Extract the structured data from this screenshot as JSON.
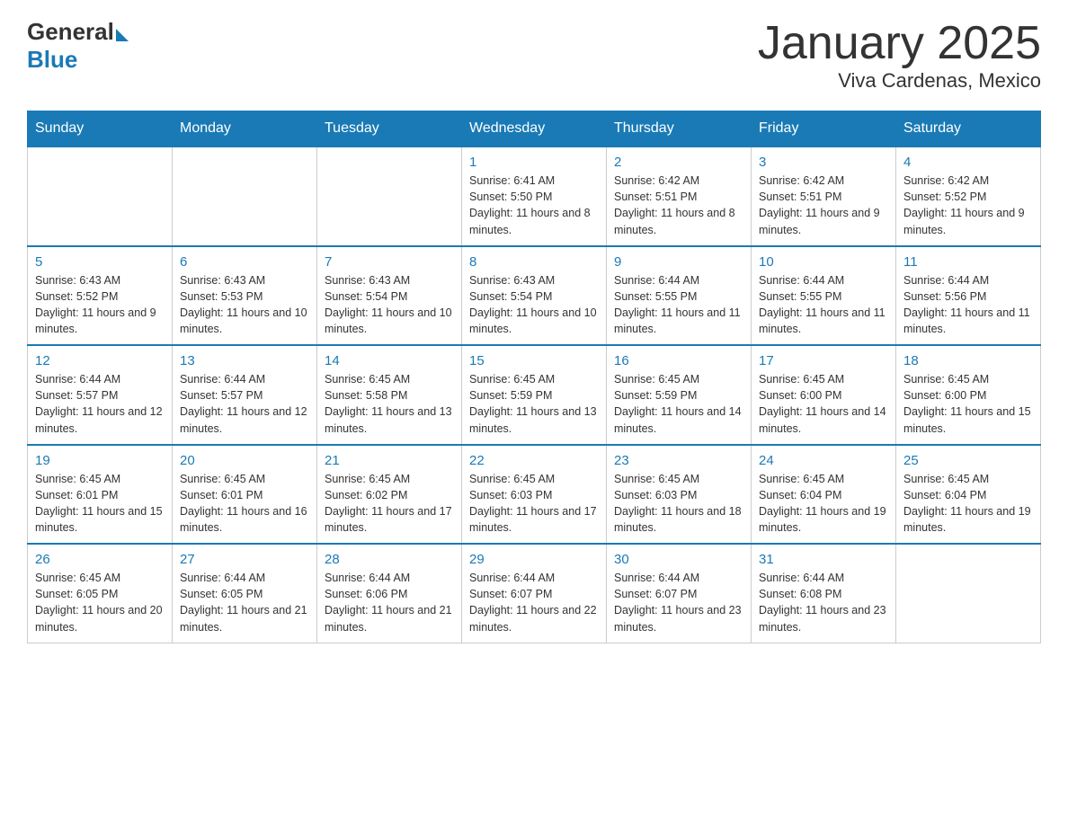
{
  "header": {
    "logo_general": "General",
    "logo_blue": "Blue",
    "month_title": "January 2025",
    "location": "Viva Cardenas, Mexico"
  },
  "days_of_week": [
    "Sunday",
    "Monday",
    "Tuesday",
    "Wednesday",
    "Thursday",
    "Friday",
    "Saturday"
  ],
  "weeks": [
    {
      "days": [
        {
          "num": "",
          "info": ""
        },
        {
          "num": "",
          "info": ""
        },
        {
          "num": "",
          "info": ""
        },
        {
          "num": "1",
          "info": "Sunrise: 6:41 AM\nSunset: 5:50 PM\nDaylight: 11 hours and 8 minutes."
        },
        {
          "num": "2",
          "info": "Sunrise: 6:42 AM\nSunset: 5:51 PM\nDaylight: 11 hours and 8 minutes."
        },
        {
          "num": "3",
          "info": "Sunrise: 6:42 AM\nSunset: 5:51 PM\nDaylight: 11 hours and 9 minutes."
        },
        {
          "num": "4",
          "info": "Sunrise: 6:42 AM\nSunset: 5:52 PM\nDaylight: 11 hours and 9 minutes."
        }
      ]
    },
    {
      "days": [
        {
          "num": "5",
          "info": "Sunrise: 6:43 AM\nSunset: 5:52 PM\nDaylight: 11 hours and 9 minutes."
        },
        {
          "num": "6",
          "info": "Sunrise: 6:43 AM\nSunset: 5:53 PM\nDaylight: 11 hours and 10 minutes."
        },
        {
          "num": "7",
          "info": "Sunrise: 6:43 AM\nSunset: 5:54 PM\nDaylight: 11 hours and 10 minutes."
        },
        {
          "num": "8",
          "info": "Sunrise: 6:43 AM\nSunset: 5:54 PM\nDaylight: 11 hours and 10 minutes."
        },
        {
          "num": "9",
          "info": "Sunrise: 6:44 AM\nSunset: 5:55 PM\nDaylight: 11 hours and 11 minutes."
        },
        {
          "num": "10",
          "info": "Sunrise: 6:44 AM\nSunset: 5:55 PM\nDaylight: 11 hours and 11 minutes."
        },
        {
          "num": "11",
          "info": "Sunrise: 6:44 AM\nSunset: 5:56 PM\nDaylight: 11 hours and 11 minutes."
        }
      ]
    },
    {
      "days": [
        {
          "num": "12",
          "info": "Sunrise: 6:44 AM\nSunset: 5:57 PM\nDaylight: 11 hours and 12 minutes."
        },
        {
          "num": "13",
          "info": "Sunrise: 6:44 AM\nSunset: 5:57 PM\nDaylight: 11 hours and 12 minutes."
        },
        {
          "num": "14",
          "info": "Sunrise: 6:45 AM\nSunset: 5:58 PM\nDaylight: 11 hours and 13 minutes."
        },
        {
          "num": "15",
          "info": "Sunrise: 6:45 AM\nSunset: 5:59 PM\nDaylight: 11 hours and 13 minutes."
        },
        {
          "num": "16",
          "info": "Sunrise: 6:45 AM\nSunset: 5:59 PM\nDaylight: 11 hours and 14 minutes."
        },
        {
          "num": "17",
          "info": "Sunrise: 6:45 AM\nSunset: 6:00 PM\nDaylight: 11 hours and 14 minutes."
        },
        {
          "num": "18",
          "info": "Sunrise: 6:45 AM\nSunset: 6:00 PM\nDaylight: 11 hours and 15 minutes."
        }
      ]
    },
    {
      "days": [
        {
          "num": "19",
          "info": "Sunrise: 6:45 AM\nSunset: 6:01 PM\nDaylight: 11 hours and 15 minutes."
        },
        {
          "num": "20",
          "info": "Sunrise: 6:45 AM\nSunset: 6:01 PM\nDaylight: 11 hours and 16 minutes."
        },
        {
          "num": "21",
          "info": "Sunrise: 6:45 AM\nSunset: 6:02 PM\nDaylight: 11 hours and 17 minutes."
        },
        {
          "num": "22",
          "info": "Sunrise: 6:45 AM\nSunset: 6:03 PM\nDaylight: 11 hours and 17 minutes."
        },
        {
          "num": "23",
          "info": "Sunrise: 6:45 AM\nSunset: 6:03 PM\nDaylight: 11 hours and 18 minutes."
        },
        {
          "num": "24",
          "info": "Sunrise: 6:45 AM\nSunset: 6:04 PM\nDaylight: 11 hours and 19 minutes."
        },
        {
          "num": "25",
          "info": "Sunrise: 6:45 AM\nSunset: 6:04 PM\nDaylight: 11 hours and 19 minutes."
        }
      ]
    },
    {
      "days": [
        {
          "num": "26",
          "info": "Sunrise: 6:45 AM\nSunset: 6:05 PM\nDaylight: 11 hours and 20 minutes."
        },
        {
          "num": "27",
          "info": "Sunrise: 6:44 AM\nSunset: 6:05 PM\nDaylight: 11 hours and 21 minutes."
        },
        {
          "num": "28",
          "info": "Sunrise: 6:44 AM\nSunset: 6:06 PM\nDaylight: 11 hours and 21 minutes."
        },
        {
          "num": "29",
          "info": "Sunrise: 6:44 AM\nSunset: 6:07 PM\nDaylight: 11 hours and 22 minutes."
        },
        {
          "num": "30",
          "info": "Sunrise: 6:44 AM\nSunset: 6:07 PM\nDaylight: 11 hours and 23 minutes."
        },
        {
          "num": "31",
          "info": "Sunrise: 6:44 AM\nSunset: 6:08 PM\nDaylight: 11 hours and 23 minutes."
        },
        {
          "num": "",
          "info": ""
        }
      ]
    }
  ]
}
